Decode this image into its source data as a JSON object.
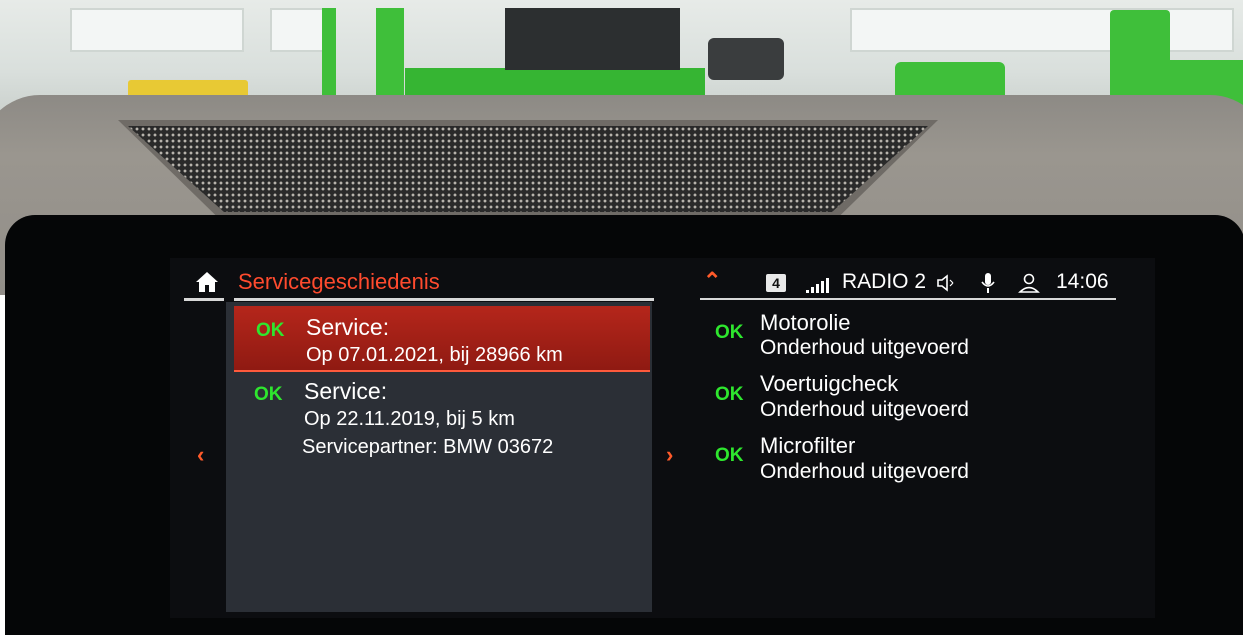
{
  "left_panel": {
    "title": "Servicegeschiedenis",
    "entries": [
      {
        "status": "OK",
        "title": "Service:",
        "lines": [
          "Op 07.01.2021, bij 28966 km"
        ]
      },
      {
        "status": "OK",
        "title": "Service:",
        "lines": [
          "Op 22.11.2019, bij 5 km",
          "Servicepartner: BMW 03672"
        ]
      }
    ]
  },
  "status_bar": {
    "badge": "4",
    "source": "RADIO 2",
    "time": "14:06"
  },
  "right_panel": {
    "items": [
      {
        "status": "OK",
        "title": "Motorolie",
        "subtitle": "Onderhoud uitgevoerd"
      },
      {
        "status": "OK",
        "title": "Voertuigcheck",
        "subtitle": "Onderhoud uitgevoerd"
      },
      {
        "status": "OK",
        "title": "Microfilter",
        "subtitle": "Onderhoud uitgevoerd"
      }
    ]
  },
  "colors": {
    "accent": "#ff4b2e",
    "ok": "#2ee62e",
    "selected_row": "#b5261b"
  }
}
